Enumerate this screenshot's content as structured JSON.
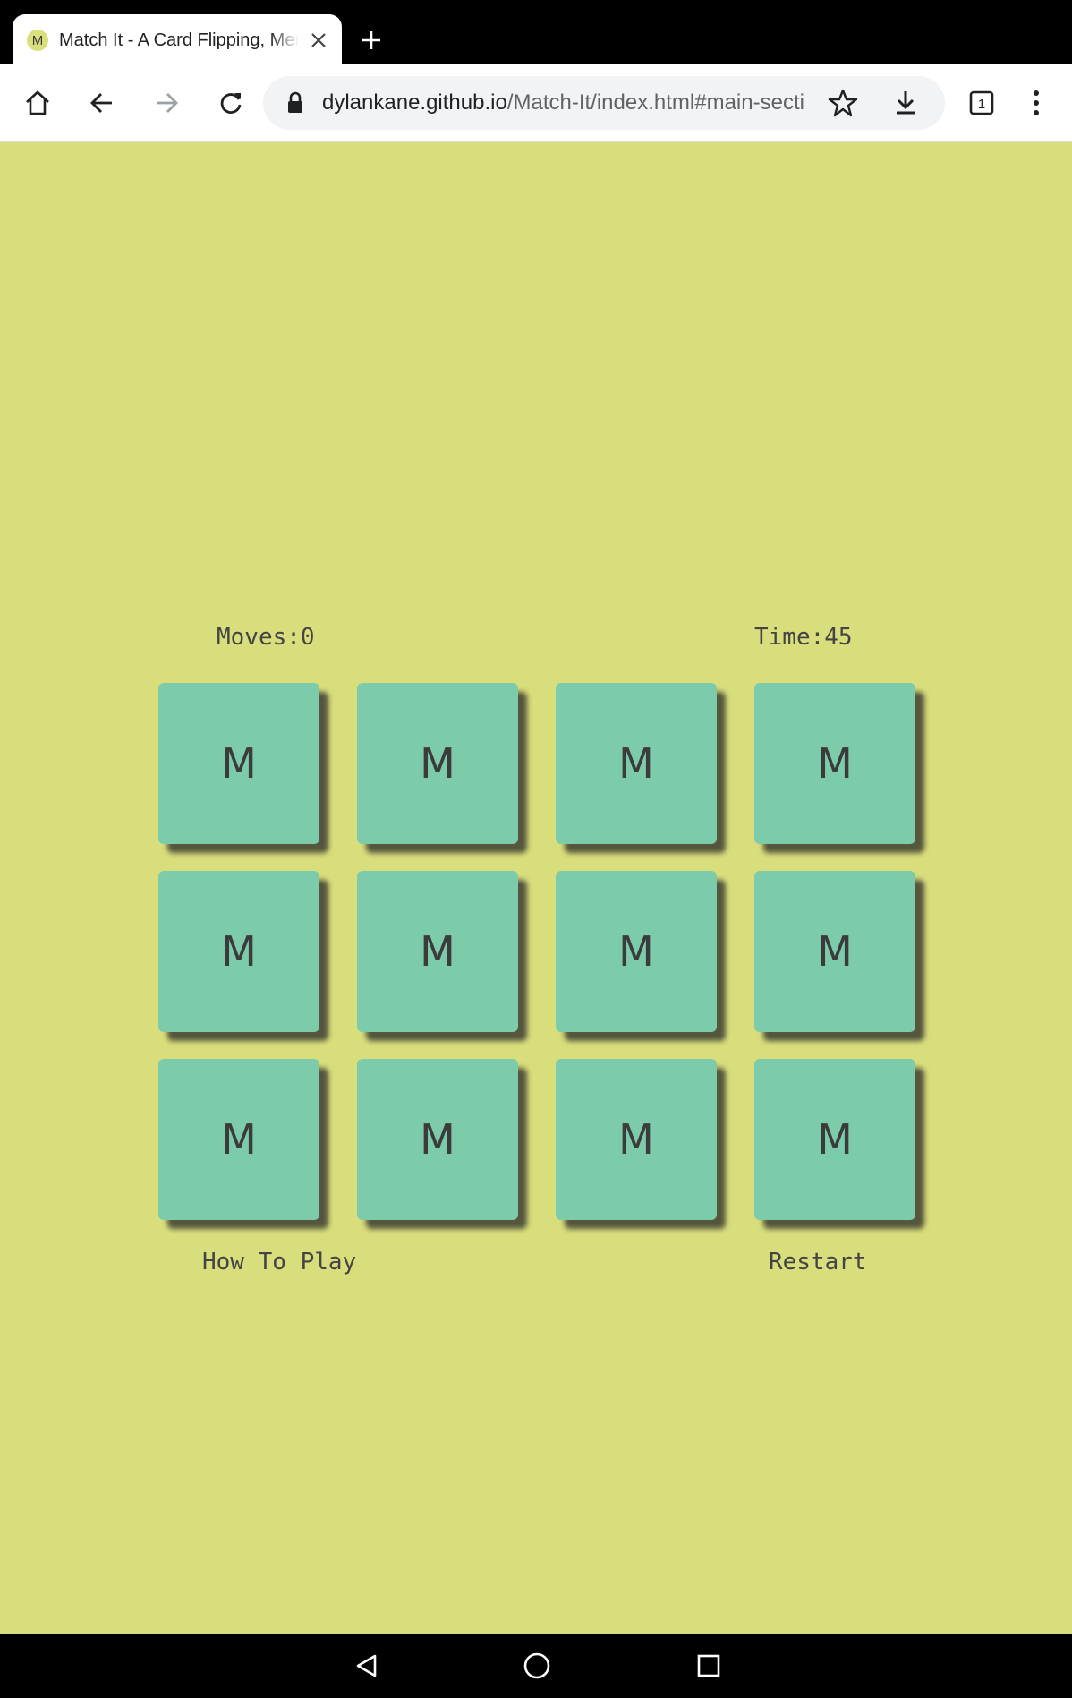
{
  "browser": {
    "tab": {
      "favicon_letter": "M",
      "title": "Match It - A Card Flipping, Memory Game"
    },
    "url": {
      "domain": "dylankane.github.io",
      "path": "/Match-It/index.html#main-section"
    },
    "tab_count": "1"
  },
  "game": {
    "moves_label": "Moves:0",
    "time_label": "Time:45",
    "cards": [
      "M",
      "M",
      "M",
      "M",
      "M",
      "M",
      "M",
      "M",
      "M",
      "M",
      "M",
      "M"
    ],
    "how_to_play_label": "How To Play",
    "restart_label": "Restart"
  },
  "colors": {
    "page_bg": "#d9de7c",
    "card_bg": "#7ccbab",
    "text": "#444444"
  }
}
